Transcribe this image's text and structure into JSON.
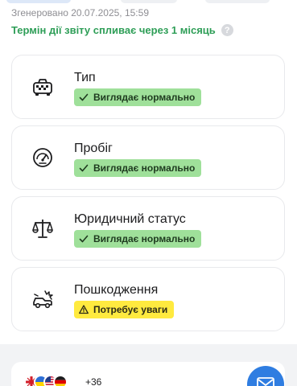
{
  "header": {
    "generated": "Згенеровано 20.07.2025, 15:59",
    "expiry": "Термін дії звіту спливає через 1 місяць",
    "help_glyph": "?"
  },
  "cards": [
    {
      "title": "Тип",
      "icon": "taxi-icon",
      "status": "Виглядає нормально",
      "status_type": "ok"
    },
    {
      "title": "Пробіг",
      "icon": "speedometer-icon",
      "status": "Виглядає нормально",
      "status_type": "ok"
    },
    {
      "title": "Юридичний статус",
      "icon": "scales-icon",
      "status": "Виглядає нормально",
      "status_type": "ok"
    },
    {
      "title": "Пошкодження",
      "icon": "damaged-car-icon",
      "status": "Потребує уваги",
      "status_type": "warning"
    }
  ],
  "footer": {
    "flags": [
      "gb-flag-icon",
      "ua-flag-icon",
      "us-flag-icon",
      "de-flag-icon"
    ],
    "more_count": "+36",
    "chat_icon": "mail-icon"
  },
  "colors": {
    "accent_green": "#2e9e57",
    "badge_ok": "#9fe09a",
    "badge_warning": "#ffea3f",
    "chat_blue": "#2f7de1"
  }
}
